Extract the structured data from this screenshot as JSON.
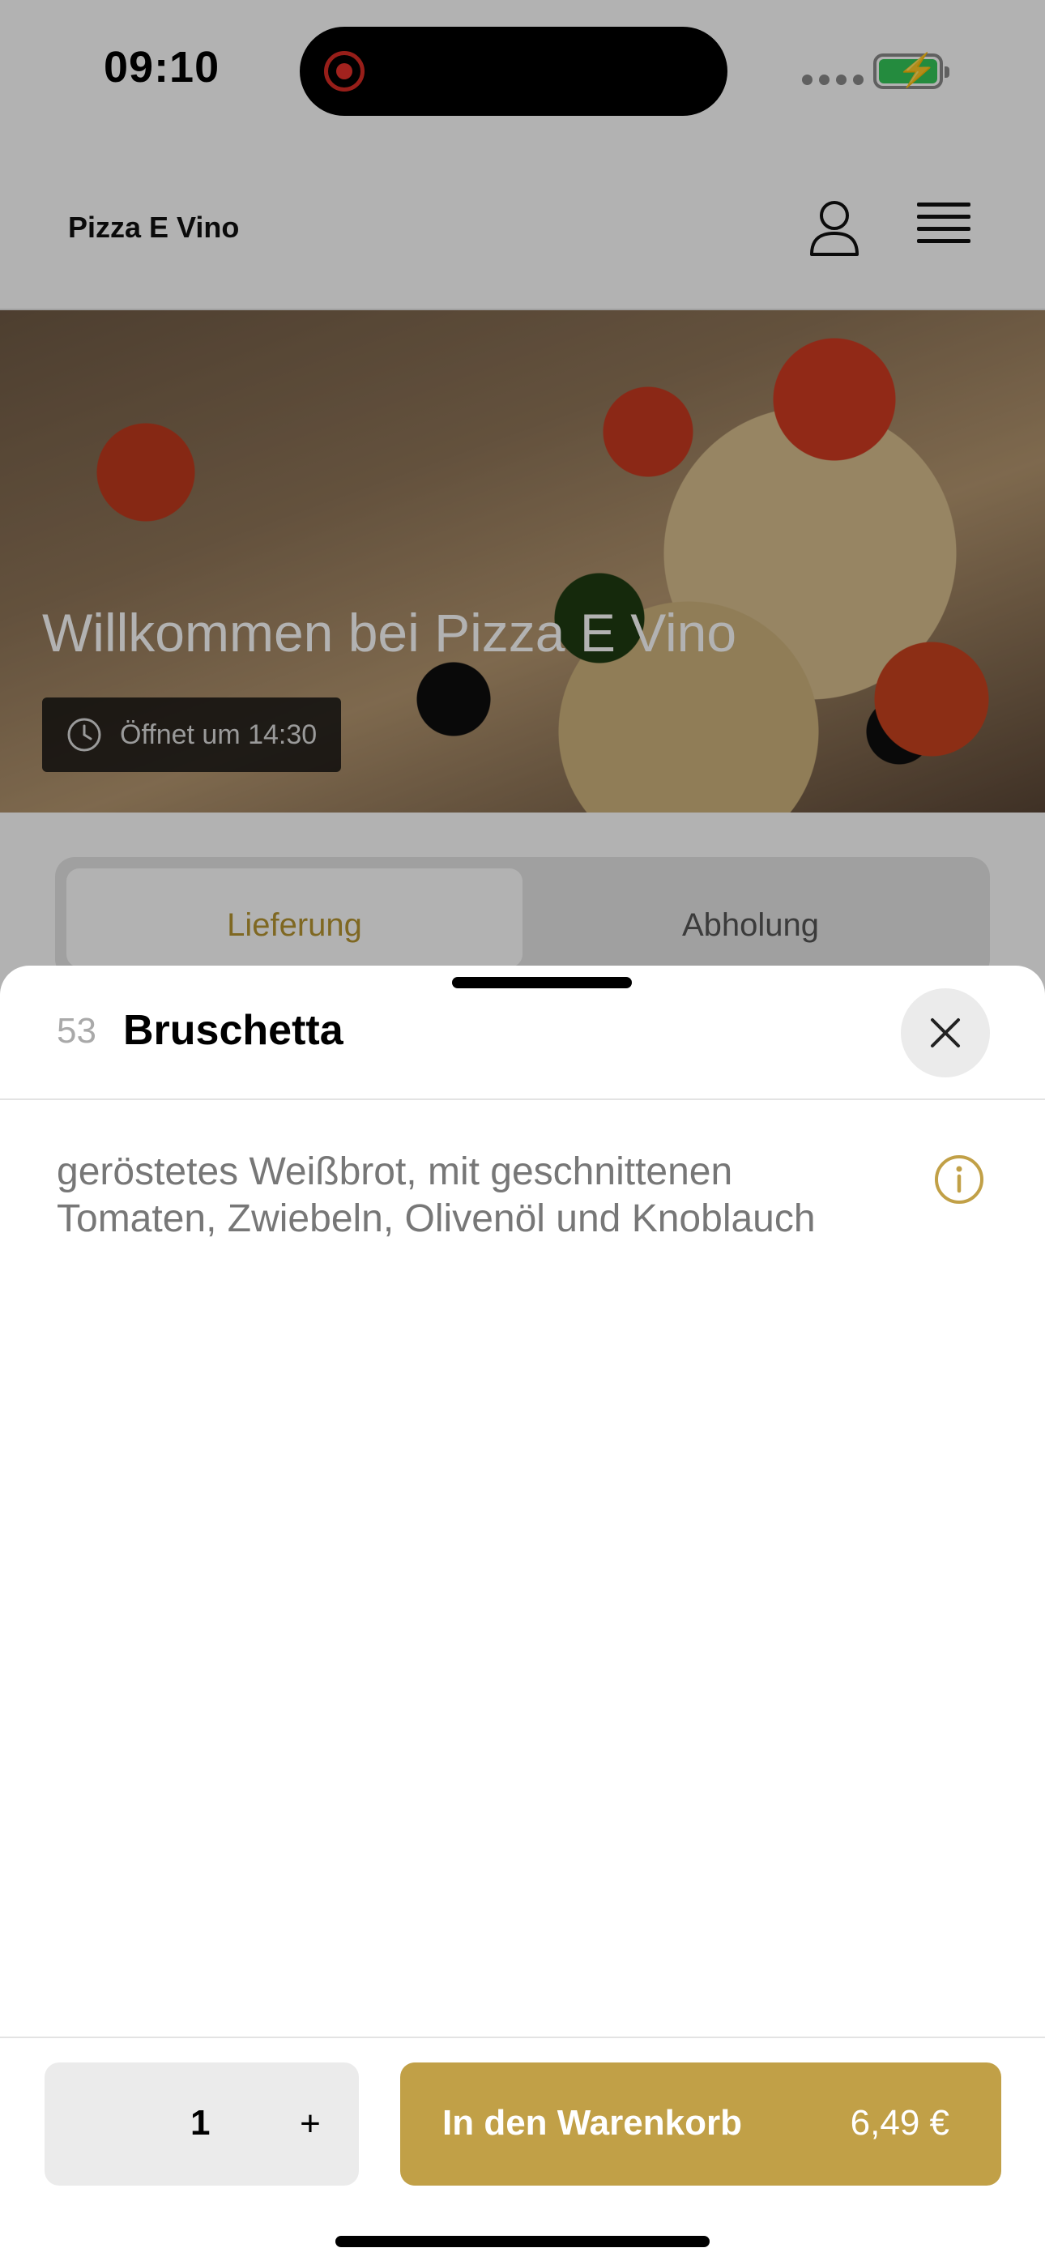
{
  "status_bar": {
    "time": "09:10",
    "icons": [
      "screen-recording-icon",
      "signal-icon",
      "battery-charging-icon"
    ]
  },
  "header": {
    "brand": "Pizza E Vino",
    "icons": [
      "user-icon",
      "menu-icon"
    ]
  },
  "hero": {
    "title": "Willkommen bei Pizza E Vino",
    "opening_badge": "Öffnet um 14:30",
    "icon": "clock-icon"
  },
  "mode_switch": {
    "tabs": [
      {
        "label": "Lieferung",
        "active": true
      },
      {
        "label": "Abholung",
        "active": false
      }
    ],
    "active_color": "#b79631"
  },
  "item_sheet": {
    "number": "53",
    "name": "Bruschetta",
    "description": "geröstetes Weißbrot, mit geschnittenen Tomaten, Zwiebeln, Olivenöl und Knoblauch",
    "icons": [
      "close-icon",
      "info-icon"
    ],
    "accent_color": "#c1a047"
  },
  "footer": {
    "quantity": "1",
    "plus": "+",
    "add_to_cart_label": "In den Warenkorb",
    "price": "6,49 €"
  }
}
